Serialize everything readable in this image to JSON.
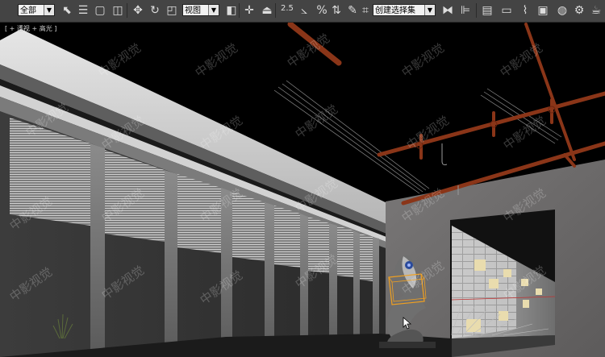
{
  "toolbar": {
    "filter_dropdown": "全部",
    "coord_dropdown": "视图",
    "snap_value": "2.5",
    "named_selection_dropdown": "创建选择集",
    "icons": [
      "select-icon",
      "select-by-name-icon",
      "rect-select-icon",
      "window-crossing-icon",
      "move-icon",
      "rotate-icon",
      "scale-icon",
      "pivot-icon",
      "mirror-icon",
      "align-icon",
      "angle-snap-icon",
      "percent-snap-icon",
      "spinner-snap-icon",
      "edit-named-icon",
      "layer-icon",
      "graphite-icon",
      "curve-editor-icon",
      "schematic-icon",
      "material-editor-icon",
      "render-setup-icon",
      "render-frame-icon",
      "render-icon"
    ]
  },
  "viewport": {
    "label": "[ + 透视 + 高光 ]",
    "watermark": "中影视觉"
  }
}
